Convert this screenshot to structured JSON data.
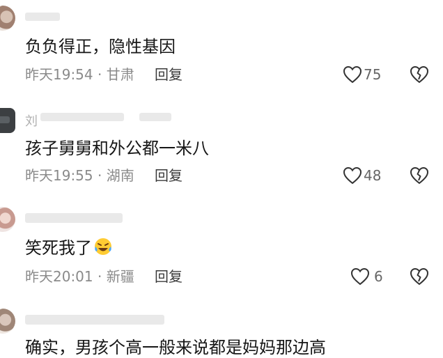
{
  "comments": [
    {
      "name": "",
      "avatar": "avatar-photo",
      "text": "负负得正，隐性基因",
      "time": "昨天19:54",
      "location": "甘肃",
      "reply_label": "回复",
      "likes": "75"
    },
    {
      "name": "刘",
      "avatar": "avatar-car",
      "text": "孩子舅舅和外公都一米八",
      "time": "昨天19:55",
      "location": "湖南",
      "reply_label": "回复",
      "likes": "48"
    },
    {
      "name": "",
      "avatar": "avatar-photo",
      "text": "笑死我了",
      "emoji": "laughing-tears-emoji",
      "time": "昨天20:01",
      "location": "新疆",
      "reply_label": "回复",
      "likes": "6"
    },
    {
      "name": "",
      "avatar": "avatar-photo",
      "text": "确实，男孩个高一般来说都是妈妈那边高"
    }
  ],
  "separator": " · ",
  "icons": {
    "like": "heart-outline-icon",
    "dislike": "broken-heart-icon"
  },
  "colors": {
    "text": "#161616",
    "meta": "#8a8a8a",
    "icon": "#333333"
  }
}
